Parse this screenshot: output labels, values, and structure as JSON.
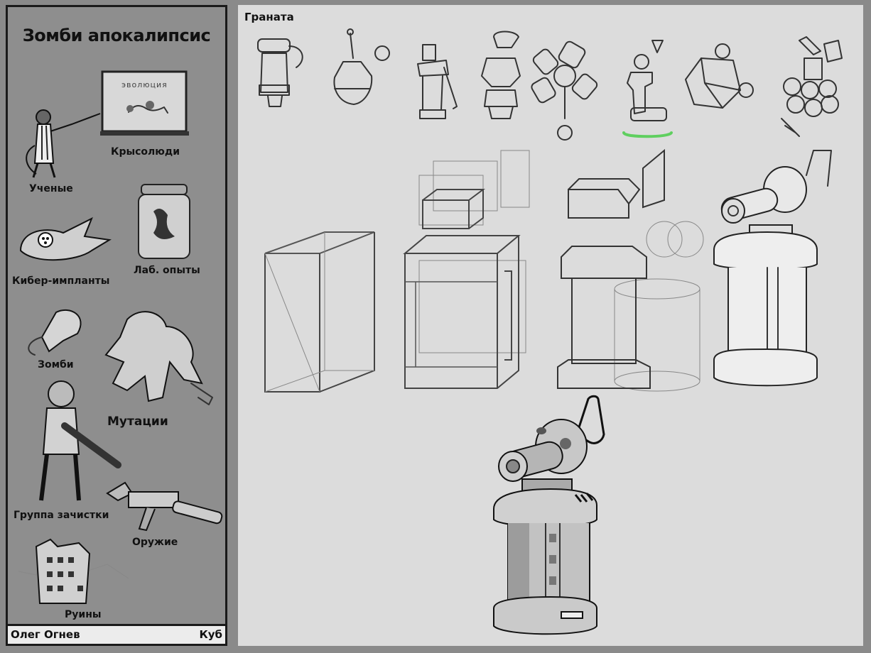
{
  "sidebar": {
    "title": "Зомби апокалипсис",
    "labels": {
      "rat_people": "Крысолюди",
      "scientists": "Ученые",
      "cyber_implants": "Кибер-импланты",
      "lab_experiments": "Лаб. опыты",
      "zombies": "Зомби",
      "mutations": "Мутации",
      "cleanup_squad": "Группа зачистки",
      "weapons": "Оружие",
      "ruins": "Руины"
    },
    "board_text": "эволюция",
    "footer": {
      "author": "Олег Огнев",
      "project": "Куб"
    }
  },
  "canvas": {
    "title": "Граната",
    "selected_thumbnail_color": "#5fcf5f"
  },
  "colors": {
    "page_bg": "#8a8a8a",
    "sidebar_bg": "#8e8e8e",
    "canvas_bg": "#dcdcdc",
    "footer_bg": "#ececec"
  }
}
